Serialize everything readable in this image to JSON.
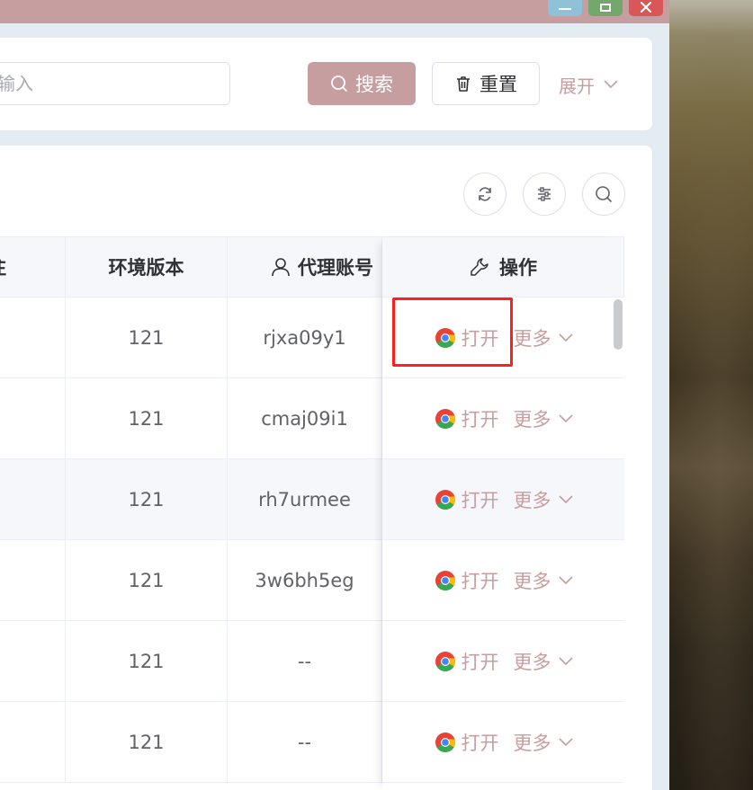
{
  "search": {
    "placeholder_fragment": "输入",
    "search_label": "搜索",
    "reset_label": "重置",
    "expand_label": "展开"
  },
  "table": {
    "headers": {
      "partial": "注",
      "version": "环境版本",
      "proxy": "代理账号",
      "operation": "操作"
    },
    "rows": [
      {
        "version": "121",
        "proxy": "rjxa09y1"
      },
      {
        "version": "121",
        "proxy": "cmaj09i1"
      },
      {
        "version": "121",
        "proxy": "rh7urmee"
      },
      {
        "version": "121",
        "proxy": "3w6bh5eg"
      },
      {
        "version": "121",
        "proxy": "--"
      },
      {
        "version": "121",
        "proxy": "--"
      }
    ],
    "open_label": "打开",
    "more_label": "更多"
  },
  "colors": {
    "accent": "#c79ea0",
    "highlight": "#ff1f1f"
  }
}
